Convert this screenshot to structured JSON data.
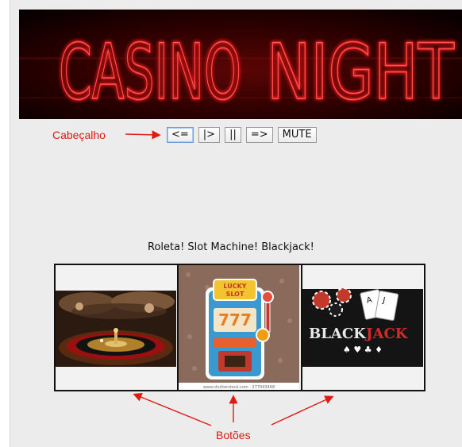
{
  "banner": {
    "title_word1": "CASINO",
    "title_word2": "NIGHT"
  },
  "controls": [
    {
      "label": "<=",
      "active": true
    },
    {
      "label": "|>"
    },
    {
      "label": "||"
    },
    {
      "label": "=>"
    },
    {
      "label": "MUTE"
    }
  ],
  "annotations": {
    "header": "Cabeçalho",
    "buttons": "Botões",
    "color": "#e01a10"
  },
  "games": {
    "title": "Roleta! Slot Machine! Blackjack!",
    "roulette_icon": "roulette-icon",
    "slot_icon": "slot-machine-icon",
    "blackjack_icon": "blackjack-icon",
    "slot_sign": "LUCKY SLOT",
    "slot_digits": "777",
    "slot_footer": "www.shutterstock.com · 277043468",
    "blackjack_word1": "BLACK",
    "blackjack_word2": "JACK",
    "suits": "♠ ♥ ♣ ♦"
  },
  "colors": {
    "neon_red": "#ff1e1e",
    "background": "#ececec"
  }
}
